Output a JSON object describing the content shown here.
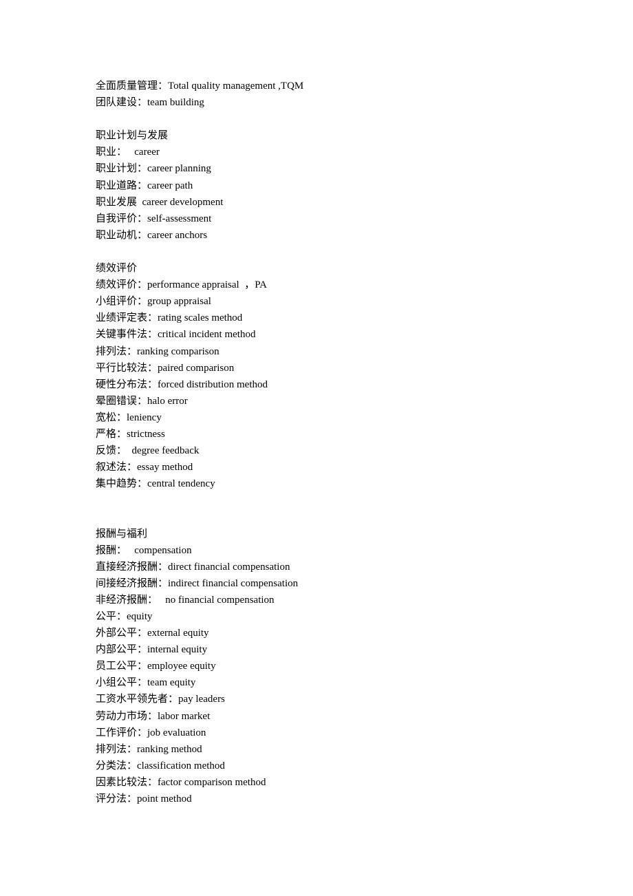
{
  "document": {
    "intro": [
      {
        "zh": "全面质量管理：",
        "en": "Total quality management ,TQM"
      },
      {
        "zh": "团队建设：",
        "en": "team building"
      }
    ],
    "sections": [
      {
        "heading": "职业计划与发展",
        "items": [
          {
            "zh": "职业：",
            "en": "   career"
          },
          {
            "zh": "职业计划：",
            "en": "career planning"
          },
          {
            "zh": "职业道路：",
            "en": "career path"
          },
          {
            "zh": "职业发展  ",
            "en": "career development"
          },
          {
            "zh": "自我评价：",
            "en": "self-assessment"
          },
          {
            "zh": "职业动机：",
            "en": "career anchors"
          }
        ]
      },
      {
        "heading": "绩效评价",
        "items": [
          {
            "zh": "绩效评价：",
            "en": "performance appraisal  ，PA"
          },
          {
            "zh": "小组评价：",
            "en": "group appraisal"
          },
          {
            "zh": "业绩评定表：",
            "en": "rating scales method"
          },
          {
            "zh": "关键事件法：",
            "en": "critical incident method"
          },
          {
            "zh": "排列法：",
            "en": "ranking comparison"
          },
          {
            "zh": "平行比较法：",
            "en": "paired comparison"
          },
          {
            "zh": "硬性分布法：",
            "en": "forced distribution method"
          },
          {
            "zh": "晕圈错误：",
            "en": "halo error"
          },
          {
            "zh": "宽松：",
            "en": "leniency"
          },
          {
            "zh": "严格：",
            "en": "strictness"
          },
          {
            "zh": "反馈：",
            "en": "  degree feedback"
          },
          {
            "zh": "叙述法：",
            "en": "essay method"
          },
          {
            "zh": "集中趋势：",
            "en": "central tendency"
          }
        ]
      },
      {
        "heading": "报酬与福利",
        "items": [
          {
            "zh": "报酬：",
            "en": "   compensation"
          },
          {
            "zh": "直接经济报酬：",
            "en": "direct financial compensation"
          },
          {
            "zh": "间接经济报酬：",
            "en": "indirect financial compensation"
          },
          {
            "zh": "非经济报酬：",
            "en": "   no financial compensation"
          },
          {
            "zh": "公平：",
            "en": "equity"
          },
          {
            "zh": "外部公平：",
            "en": "external equity"
          },
          {
            "zh": "内部公平：",
            "en": "internal equity"
          },
          {
            "zh": "员工公平：",
            "en": "employee equity"
          },
          {
            "zh": "小组公平：",
            "en": "team equity"
          },
          {
            "zh": "工资水平领先者：",
            "en": "pay leaders"
          },
          {
            "zh": "劳动力市场：",
            "en": "labor market"
          },
          {
            "zh": "工作评价：",
            "en": "job evaluation"
          },
          {
            "zh": "排列法：",
            "en": "ranking method"
          },
          {
            "zh": "分类法：",
            "en": "classification method"
          },
          {
            "zh": "因素比较法：",
            "en": "factor comparison method"
          },
          {
            "zh": "评分法：",
            "en": "point method"
          }
        ]
      }
    ]
  }
}
